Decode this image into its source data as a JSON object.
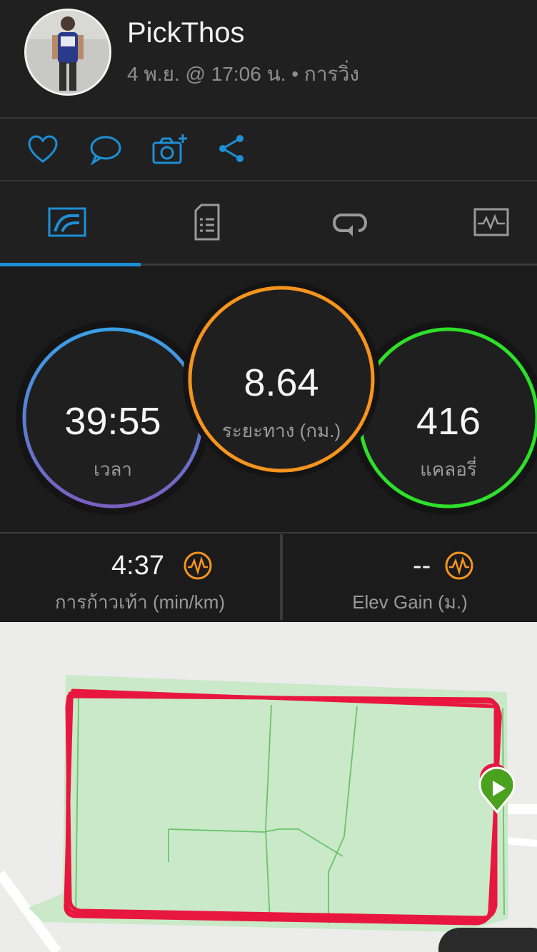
{
  "header": {
    "username": "PickThos",
    "subtitle": "4 พ.ย. @ 17:06 น. • การวิ่ง"
  },
  "actions": [
    "heart-icon",
    "comment-icon",
    "camera-add-icon",
    "share-icon"
  ],
  "tabs": [
    "stats-tab-icon",
    "details-tab-icon",
    "laps-tab-icon",
    "chart-tab-icon"
  ],
  "stats": {
    "time": {
      "value": "39:55",
      "label": "เวลา"
    },
    "distance": {
      "value": "8.64",
      "label": "ระยะทาง (กม.)"
    },
    "calories": {
      "value": "416",
      "label": "แคลอรี่"
    }
  },
  "metrics": {
    "pace": {
      "value": "4:37",
      "label": "การก้าวเท้า (min/km)"
    },
    "elev": {
      "value": "--",
      "label": "Elev Gain (ม.)"
    }
  },
  "colors": {
    "accent": "#1d8fd6",
    "distance_ring": "#f7941d",
    "calories_ring": "#2ee02a",
    "route": "#e8173f",
    "park": "#c9e9c8",
    "start_marker": "#4aa11d"
  }
}
